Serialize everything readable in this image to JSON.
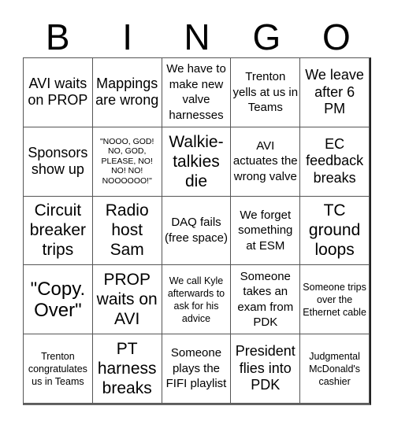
{
  "header": {
    "letters": [
      "B",
      "I",
      "N",
      "G",
      "O"
    ]
  },
  "cells": [
    {
      "text": "AVI waits on PROP",
      "size": "s-lg"
    },
    {
      "text": "Mappings are wrong",
      "size": "s-lg"
    },
    {
      "text": "We have to make new valve harnesses",
      "size": "s-md"
    },
    {
      "text": "Trenton yells at us in Teams",
      "size": "s-md"
    },
    {
      "text": "We leave after 6 PM",
      "size": "s-lg"
    },
    {
      "text": "Sponsors show up",
      "size": "s-lg"
    },
    {
      "text": "\"NOOO, GOD! NO, GOD, PLEASE, NO! NO! NO! NOOOOOO!\"",
      "size": "s-xs"
    },
    {
      "text": "Walkie-talkies die",
      "size": "s-xl"
    },
    {
      "text": "AVI actuates the wrong valve",
      "size": "s-md"
    },
    {
      "text": "EC feedback breaks",
      "size": "s-lg"
    },
    {
      "text": "Circuit breaker trips",
      "size": "s-xl"
    },
    {
      "text": "Radio host Sam",
      "size": "s-xl"
    },
    {
      "text": "DAQ fails (free space)",
      "size": "s-md"
    },
    {
      "text": "We forget something at ESM",
      "size": "s-md"
    },
    {
      "text": "TC ground loops",
      "size": "s-xl"
    },
    {
      "text": "\"Copy. Over\"",
      "size": "s-xxl"
    },
    {
      "text": "PROP waits on AVI",
      "size": "s-xl"
    },
    {
      "text": "We call Kyle afterwards to ask for his advice",
      "size": "s-sm"
    },
    {
      "text": "Someone takes an exam from PDK",
      "size": "s-md"
    },
    {
      "text": "Someone trips over the Ethernet cable",
      "size": "s-sm"
    },
    {
      "text": "Trenton congratulates us in Teams",
      "size": "s-sm"
    },
    {
      "text": "PT harness breaks",
      "size": "s-xl"
    },
    {
      "text": "Someone plays the FIFI playlist",
      "size": "s-md"
    },
    {
      "text": "President flies into PDK",
      "size": "s-lg"
    },
    {
      "text": "Judgmental McDonald's cashier",
      "size": "s-sm"
    }
  ]
}
